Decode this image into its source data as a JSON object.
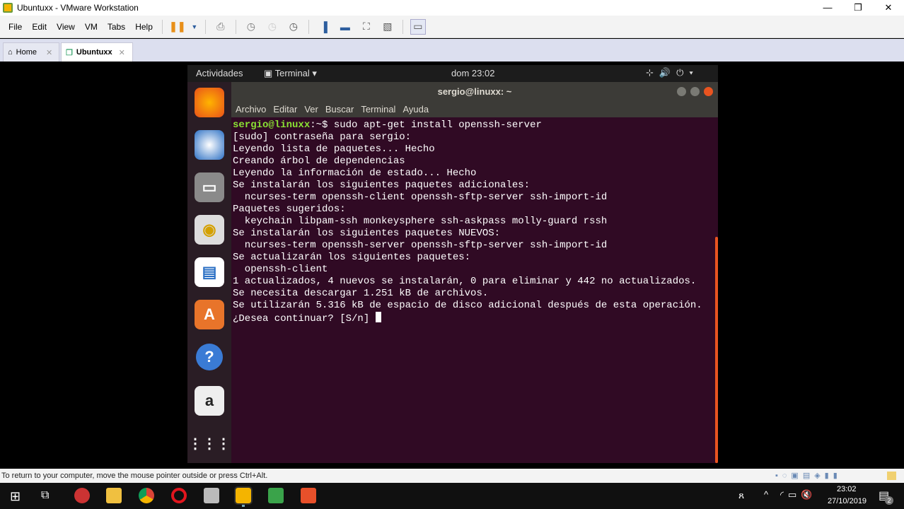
{
  "window": {
    "title": "Ubuntuxx - VMware Workstation",
    "minimize": "—",
    "restore": "❐",
    "close": "✕"
  },
  "menu": [
    "File",
    "Edit",
    "View",
    "VM",
    "Tabs",
    "Help"
  ],
  "tabs": [
    {
      "label": "Home"
    },
    {
      "label": "Ubuntuxx"
    }
  ],
  "ubuntu": {
    "activities": "Actividades",
    "app": "Terminal",
    "clock": "dom 23:02"
  },
  "terminal": {
    "title": "sergio@linuxx: ~",
    "menu": [
      "Archivo",
      "Editar",
      "Ver",
      "Buscar",
      "Terminal",
      "Ayuda"
    ],
    "prompt": "sergio@linuxx",
    "prompt_path": ":~$ ",
    "command": "sudo apt-get install openssh-server",
    "lines": [
      "[sudo] contraseña para sergio:",
      "Leyendo lista de paquetes... Hecho",
      "Creando árbol de dependencias",
      "Leyendo la información de estado... Hecho",
      "Se instalarán los siguientes paquetes adicionales:",
      "  ncurses-term openssh-client openssh-sftp-server ssh-import-id",
      "Paquetes sugeridos:",
      "  keychain libpam-ssh monkeysphere ssh-askpass molly-guard rssh",
      "Se instalarán los siguientes paquetes NUEVOS:",
      "  ncurses-term openssh-server openssh-sftp-server ssh-import-id",
      "Se actualizarán los siguientes paquetes:",
      "  openssh-client",
      "1 actualizados, 4 nuevos se instalarán, 0 para eliminar y 442 no actualizados.",
      "Se necesita descargar 1.251 kB de archivos.",
      "Se utilizarán 5.316 kB de espacio de disco adicional después de esta operación."
    ],
    "last": "¿Desea continuar? [S/n] "
  },
  "status": "To return to your computer, move the mouse pointer outside or press Ctrl+Alt.",
  "tray": {
    "time": "23:02",
    "date": "27/10/2019",
    "notifications": "2"
  }
}
